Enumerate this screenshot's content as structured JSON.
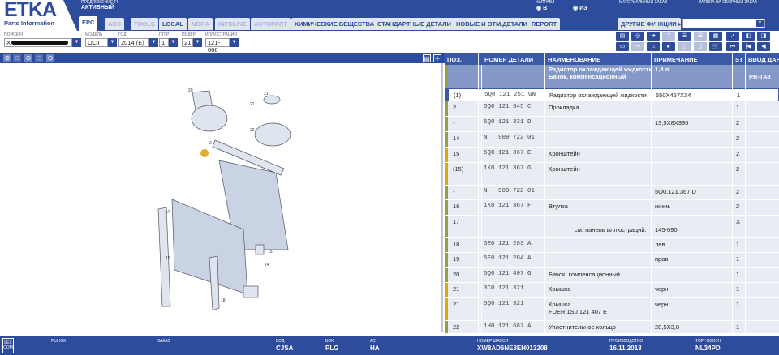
{
  "app": {
    "logo": "ETKA",
    "logo_sub": "Parts Information"
  },
  "header": {
    "fi_label": "ПРЕДЛОЖЕНИЕ FI",
    "fi_value": "АКТИВНЫЙ",
    "direction_label": "НАПРАВЛ",
    "dir_in": "В",
    "dir_out": "ИЗ",
    "material_order": "МАТЕРИАЛЬНЫЙ ЗАКАЗ",
    "assembly_order": "ЗАЯВКА НА СБОРНЫЙ ЗАКАЗ"
  },
  "tabs": [
    {
      "label": "EPC"
    },
    {
      "label": "ACC"
    },
    {
      "label": "TOOLS"
    },
    {
      "label": "LOCAL"
    },
    {
      "label": "NORA"
    },
    {
      "label": "INFOLINE"
    },
    {
      "label": "AUTOPART"
    },
    {
      "label": "ХИМИЧЕСКИЕ ВЕЩЕСТВА"
    },
    {
      "label": "СТАНДАРТНЫЕ ДЕТАЛИ"
    },
    {
      "label": "НОВЫЕ И ОТМ.ДЕТАЛИ"
    },
    {
      "label": "REPORT"
    }
  ],
  "other_functions": "ДРУГИЕ ФУНКЦИИ ▸",
  "filters": {
    "search_label": "ПОИСК FI",
    "search_value": "X",
    "model_label": "МОДЕЛЬ",
    "model_value": "OCT",
    "year_label": "ГОД",
    "year_value": "2014 (E)",
    "group_label": "ПГГР",
    "group_value": "1",
    "subgroup_label": "ПОДГР",
    "subgroup_value": "21",
    "illustration_label": "ИЛЛЮСТРАЦИЯ",
    "illustration_value": "121-066"
  },
  "table": {
    "headers": [
      "ПОЗ.",
      "",
      "НОМЕР ДЕТАЛИ",
      "НАИМЕНОВАНИЕ",
      "ПРИМЕЧАНИЕ",
      "ST",
      "ВВОД ДАН"
    ],
    "subheader": {
      "name1": "Радиатор охлаждающей жидкости",
      "name2": "Бачок, компенсационный",
      "note": "1,8 л.",
      "input": "PR-TA8"
    },
    "rows": [
      {
        "pos": "(1)",
        "part": "5Q0 121 251 GN",
        "name": "Радиатор охлаждающей жидкости",
        "note": "650X457X34",
        "st": "1",
        "color": "#3a5aa8"
      },
      {
        "pos": "2",
        "part": "5Q0 121 345 C",
        "name": "Прокладка",
        "note": "",
        "st": "1",
        "color": "#8fa33a"
      },
      {
        "pos": "-",
        "part": "5Q0 121 331 D",
        "name": "",
        "note": "13,5X8X395",
        "st": "2",
        "color": "#8fa33a"
      },
      {
        "pos": "14",
        "part": "N   909 722 01",
        "name": "",
        "note": "",
        "st": "2",
        "color": "#8fa33a"
      },
      {
        "pos": "15",
        "part": "5Q0 121 367 E",
        "name": "Кронштейн",
        "note": "",
        "st": "2",
        "color": "#e0a800"
      },
      {
        "pos": "(15)",
        "part": "1K0 121 367 G",
        "name": "Кронштейн",
        "note": "",
        "st": "2",
        "color": "#e0a800"
      },
      {
        "pos": "-",
        "part": "N   909 722 01",
        "name": "",
        "note": "5Q0.121.367.D",
        "st": "2",
        "color": "#8fa33a"
      },
      {
        "pos": "16",
        "part": "1K0 121 367 F",
        "name": "Втулка",
        "note": "нижн.",
        "st": "2",
        "color": "#8fa33a"
      },
      {
        "pos": "17",
        "part": "",
        "name": "см. панель иллюстраций:",
        "note": "145-090",
        "st": "X",
        "color": "#8fa33a"
      },
      {
        "pos": "18",
        "part": "5E0 121 283 A",
        "name": "",
        "note": "лев.",
        "st": "1",
        "color": "#8fa33a"
      },
      {
        "pos": "19",
        "part": "5E0 121 284 A",
        "name": "",
        "note": "прав.",
        "st": "1",
        "color": "#8fa33a"
      },
      {
        "pos": "20",
        "part": "5Q0 121 407 G",
        "name": "Бачок, компенсационный",
        "note": "",
        "st": "1",
        "color": "#8fa33a"
      },
      {
        "pos": "21",
        "part": "3C0 121 321",
        "name": "Крышка",
        "note": "черн.",
        "st": "1",
        "color": "#e0a800"
      },
      {
        "pos": "21",
        "part": "5Q0 121 321",
        "name": "Крышка",
        "name2": "FUER 1S0 121 407 E",
        "note": "черн.",
        "st": "1",
        "color": "#e0a800"
      },
      {
        "pos": "22",
        "part": "1H0 121 687 A",
        "name": "Уплотнительное кольцо",
        "note": "28,5X3,8",
        "st": "1",
        "color": "#8fa33a"
      }
    ]
  },
  "diagram": {
    "callouts": [
      "20",
      "21",
      "20",
      "21",
      "2",
      "1",
      "17",
      "19",
      "18",
      "15",
      "14"
    ]
  },
  "status": {
    "logo": "LEX COM",
    "market_label": "РЫНОК",
    "order_label": "ЗАКАЗ",
    "vod_label": "ВОД",
    "vod": "CJSA",
    "kpp_label": "БОК",
    "kpp": "PLG",
    "ac_label": "АС",
    "ac": "HA",
    "chassis_label": "НОМЕР ШАССИ",
    "chassis": "XW8AD6NE3EH013208",
    "prod_label": "ПРОИЗВОДСТВО",
    "prod": "16.11.2013",
    "trade_label": "ТОРГ.ОБОЗН.",
    "trade": "NL34PD"
  }
}
